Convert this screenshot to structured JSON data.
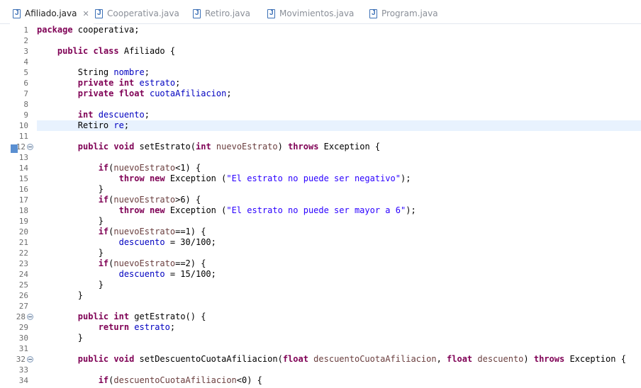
{
  "tabs": [
    {
      "label": "Afiliado.java",
      "active": true,
      "icon": "java-file-icon",
      "close": "✕"
    },
    {
      "label": "Cooperativa.java",
      "active": false,
      "icon": "java-file-icon"
    },
    {
      "label": "Retiro.java",
      "active": false,
      "icon": "java-file-icon"
    },
    {
      "label": "Movimientos.java",
      "active": false,
      "icon": "java-file-icon"
    },
    {
      "label": "Program.java",
      "active": false,
      "icon": "java-file-icon"
    }
  ],
  "editor": {
    "current_line": 10,
    "fold_lines": [
      12,
      28,
      32
    ],
    "lines": [
      {
        "n": "1",
        "tokens": [
          [
            "kw",
            "package"
          ],
          [
            "t",
            " cooperativa;"
          ]
        ]
      },
      {
        "n": "2",
        "tokens": []
      },
      {
        "n": "3",
        "tokens": [
          [
            "t",
            "    "
          ],
          [
            "kw",
            "public"
          ],
          [
            "t",
            " "
          ],
          [
            "kw",
            "class"
          ],
          [
            "t",
            " Afiliado {"
          ]
        ]
      },
      {
        "n": "4",
        "tokens": []
      },
      {
        "n": "5",
        "tokens": [
          [
            "t",
            "        String "
          ],
          [
            "field",
            "nombre"
          ],
          [
            "t",
            ";"
          ]
        ]
      },
      {
        "n": "6",
        "tokens": [
          [
            "t",
            "        "
          ],
          [
            "kw",
            "private"
          ],
          [
            "t",
            " "
          ],
          [
            "kw",
            "int"
          ],
          [
            "t",
            " "
          ],
          [
            "field",
            "estrato"
          ],
          [
            "t",
            ";"
          ]
        ]
      },
      {
        "n": "7",
        "tokens": [
          [
            "t",
            "        "
          ],
          [
            "kw",
            "private"
          ],
          [
            "t",
            " "
          ],
          [
            "kw",
            "float"
          ],
          [
            "t",
            " "
          ],
          [
            "field",
            "cuotaAfiliacion"
          ],
          [
            "t",
            ";"
          ]
        ]
      },
      {
        "n": "8",
        "tokens": []
      },
      {
        "n": "9",
        "tokens": [
          [
            "t",
            "        "
          ],
          [
            "kw",
            "int"
          ],
          [
            "t",
            " "
          ],
          [
            "field",
            "descuento"
          ],
          [
            "t",
            ";"
          ]
        ]
      },
      {
        "n": "10",
        "tokens": [
          [
            "t",
            "        Retiro "
          ],
          [
            "field",
            "re"
          ],
          [
            "t",
            ";"
          ]
        ]
      },
      {
        "n": "11",
        "tokens": []
      },
      {
        "n": "12",
        "tokens": [
          [
            "t",
            "        "
          ],
          [
            "kw",
            "public"
          ],
          [
            "t",
            " "
          ],
          [
            "kw",
            "void"
          ],
          [
            "t",
            " setEstrato("
          ],
          [
            "kw",
            "int"
          ],
          [
            "t",
            " "
          ],
          [
            "var",
            "nuevoEstrato"
          ],
          [
            "t",
            ") "
          ],
          [
            "kw",
            "throws"
          ],
          [
            "t",
            " Exception {"
          ]
        ]
      },
      {
        "n": "13",
        "tokens": []
      },
      {
        "n": "14",
        "tokens": [
          [
            "t",
            "            "
          ],
          [
            "kw",
            "if"
          ],
          [
            "t",
            "("
          ],
          [
            "var",
            "nuevoEstrato"
          ],
          [
            "t",
            "<1) {"
          ]
        ]
      },
      {
        "n": "15",
        "tokens": [
          [
            "t",
            "                "
          ],
          [
            "kw",
            "throw"
          ],
          [
            "t",
            " "
          ],
          [
            "kw",
            "new"
          ],
          [
            "t",
            " Exception ("
          ],
          [
            "str",
            "\"El estrato no puede ser negativo\""
          ],
          [
            "t",
            ");"
          ]
        ]
      },
      {
        "n": "16",
        "tokens": [
          [
            "t",
            "            }"
          ]
        ]
      },
      {
        "n": "17",
        "tokens": [
          [
            "t",
            "            "
          ],
          [
            "kw",
            "if"
          ],
          [
            "t",
            "("
          ],
          [
            "var",
            "nuevoEstrato"
          ],
          [
            "t",
            ">6) {"
          ]
        ]
      },
      {
        "n": "18",
        "tokens": [
          [
            "t",
            "                "
          ],
          [
            "kw",
            "throw"
          ],
          [
            "t",
            " "
          ],
          [
            "kw",
            "new"
          ],
          [
            "t",
            " Exception ("
          ],
          [
            "str",
            "\"El estrato no puede ser mayor a 6\""
          ],
          [
            "t",
            ");"
          ]
        ]
      },
      {
        "n": "19",
        "tokens": [
          [
            "t",
            "            }"
          ]
        ]
      },
      {
        "n": "20",
        "tokens": [
          [
            "t",
            "            "
          ],
          [
            "kw",
            "if"
          ],
          [
            "t",
            "("
          ],
          [
            "var",
            "nuevoEstrato"
          ],
          [
            "t",
            "==1) {"
          ]
        ]
      },
      {
        "n": "21",
        "tokens": [
          [
            "t",
            "                "
          ],
          [
            "field",
            "descuento"
          ],
          [
            "t",
            " = 30/100;"
          ]
        ]
      },
      {
        "n": "22",
        "tokens": [
          [
            "t",
            "            }"
          ]
        ]
      },
      {
        "n": "23",
        "tokens": [
          [
            "t",
            "            "
          ],
          [
            "kw",
            "if"
          ],
          [
            "t",
            "("
          ],
          [
            "var",
            "nuevoEstrato"
          ],
          [
            "t",
            "==2) {"
          ]
        ]
      },
      {
        "n": "24",
        "tokens": [
          [
            "t",
            "                "
          ],
          [
            "field",
            "descuento"
          ],
          [
            "t",
            " = 15/100;"
          ]
        ]
      },
      {
        "n": "25",
        "tokens": [
          [
            "t",
            "            }"
          ]
        ]
      },
      {
        "n": "26",
        "tokens": [
          [
            "t",
            "        }"
          ]
        ]
      },
      {
        "n": "27",
        "tokens": []
      },
      {
        "n": "28",
        "tokens": [
          [
            "t",
            "        "
          ],
          [
            "kw",
            "public"
          ],
          [
            "t",
            " "
          ],
          [
            "kw",
            "int"
          ],
          [
            "t",
            " getEstrato() {"
          ]
        ]
      },
      {
        "n": "29",
        "tokens": [
          [
            "t",
            "            "
          ],
          [
            "kw",
            "return"
          ],
          [
            "t",
            " "
          ],
          [
            "field",
            "estrato"
          ],
          [
            "t",
            ";"
          ]
        ]
      },
      {
        "n": "30",
        "tokens": [
          [
            "t",
            "        }"
          ]
        ]
      },
      {
        "n": "31",
        "tokens": []
      },
      {
        "n": "32",
        "tokens": [
          [
            "t",
            "        "
          ],
          [
            "kw",
            "public"
          ],
          [
            "t",
            " "
          ],
          [
            "kw",
            "void"
          ],
          [
            "t",
            " setDescuentoCuotaAfiliacion("
          ],
          [
            "kw",
            "float"
          ],
          [
            "t",
            " "
          ],
          [
            "var",
            "descuentoCuotaAfiliacion"
          ],
          [
            "t",
            ", "
          ],
          [
            "kw",
            "float"
          ],
          [
            "t",
            " "
          ],
          [
            "var",
            "descuento"
          ],
          [
            "t",
            ") "
          ],
          [
            "kw",
            "throws"
          ],
          [
            "t",
            " Exception {"
          ]
        ]
      },
      {
        "n": "33",
        "tokens": []
      },
      {
        "n": "34",
        "tokens": [
          [
            "t",
            "            "
          ],
          [
            "kw",
            "if"
          ],
          [
            "t",
            "("
          ],
          [
            "var",
            "descuentoCuotaAfiliacion"
          ],
          [
            "t",
            "<0) {"
          ]
        ]
      }
    ]
  }
}
